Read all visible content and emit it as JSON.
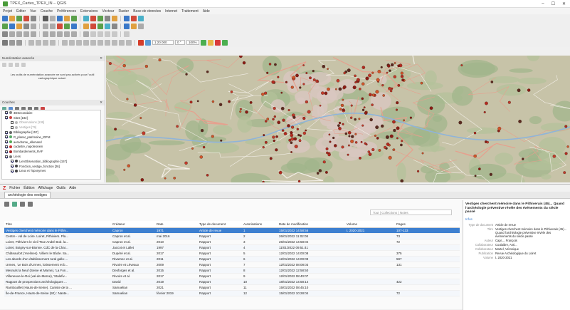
{
  "app": {
    "title": "TPEX_Cartes_TPEX_IN – QGIS"
  },
  "menubar": [
    "Projet",
    "Éditer",
    "Vue",
    "Couche",
    "Préférences",
    "Extensions",
    "Vecteur",
    "Raster",
    "Base de données",
    "Internet",
    "Traitement",
    "Aide"
  ],
  "window_controls": [
    "–",
    "☐",
    "✕"
  ],
  "scale": {
    "value": "1:20 000",
    "rotation": "0 °",
    "zoom": "100%"
  },
  "left_panel": {
    "title1": "Numérotation avancée",
    "warning": "Les outils de numérotation avancée ne sont pas activés pour l'outil cartographique actuel.",
    "title2": "Couches",
    "layers": [
      {
        "label": "3DSecondaire",
        "checked": true,
        "color": "#888"
      },
      {
        "label": "Sites [192]",
        "checked": true,
        "color": "#c44"
      },
      {
        "label": "Observations [136]",
        "checked": false,
        "color": "#bbb"
      },
      {
        "label": "Vestiges [79]",
        "checked": false,
        "color": "#bbb"
      },
      {
        "label": "Bibliographie [157]",
        "checked": true,
        "color": "#666"
      },
      {
        "label": "R_planar_patrimoine_IDFM",
        "checked": true,
        "color": "#5a6"
      },
      {
        "label": "aerodrome_allemand",
        "checked": true,
        "color": "#5a5"
      },
      {
        "label": "cadastre_napoleonien",
        "checked": true,
        "color": "#c33"
      },
      {
        "label": "Bombardements_RAF",
        "checked": true,
        "color": "#a22"
      },
      {
        "label": "Liens",
        "checked": true,
        "color": "#777"
      },
      {
        "label": "LienObservation_bibliographie [157]",
        "checked": true,
        "color": "#444"
      },
      {
        "label": "Fonction_vestige_fonction [26]",
        "checked": true,
        "color": "#444"
      },
      {
        "label": "Lieux et Toponymes",
        "checked": true,
        "color": "#444"
      }
    ]
  },
  "attribute_table": {
    "menu": [
      "Fichier",
      "Édition",
      "Affichage",
      "Outils",
      "Aide"
    ],
    "tab": "archéologie des vestiges",
    "search_placeholder": "Tout | Collections | Notes",
    "columns": [
      "Titre",
      "Créateur",
      "Date",
      "Type de document",
      "Autorisations",
      "Date de modification",
      "Volume",
      "Pages"
    ],
    "rows": [
      {
        "c": [
          "Vestiges cherchent mémoire dans le Pithiv...",
          "Capron",
          "1971",
          "Article de revue",
          "1",
          "15/01/2022 14:58:56",
          "t. 2020-2021",
          "107-133"
        ],
        "selected": true
      },
      {
        "c": [
          "Centre - val de Loire. Loiret, Pithiviers. Pla...",
          "Capron et al.",
          "mai 2016",
          "Rapport",
          "2",
          "26/01/2022 11:02:08",
          "",
          "73"
        ],
        "selected": false
      },
      {
        "c": [
          "Loiret, Pithiviers le vieil 'Rue André Bob. la...",
          "Capron et al.",
          "2010",
          "Rapport",
          "3",
          "26/01/2022 14:58:04",
          "",
          "72"
        ],
        "selected": false
      },
      {
        "c": [
          "Loiret, Boigny-sur-Bionne. CdC de la Char...",
          "Jaccot et Lallet",
          "1997",
          "Rapport",
          "4",
          "11/01/2022 09:51:41",
          "",
          "",
          ""
        ],
        "selected": false
      },
      {
        "c": [
          "Châteaufort (Yvelines). Villiers le Bâcle. Sa...",
          "Dupéré et al.",
          "2017",
          "Rapport",
          "5",
          "12/01/2022 14:00:08",
          "",
          "375"
        ],
        "selected": false
      },
      {
        "c": [
          "Les abords d'un établissement rural gallo-...",
          "Rivarnec et al.",
          "2011",
          "Rapport",
          "6",
          "12/01/2022 14:00:09",
          "",
          "597"
        ],
        "selected": false
      },
      {
        "c": [
          "Urmes, 'Le Bois d'Urmes, lotissement et b...",
          "Rivoire et Léveaux",
          "2009",
          "Rapport",
          "7",
          "12/01/2022 08:08:03",
          "",
          "131"
        ],
        "selected": false
      },
      {
        "c": [
          "Mesnuls la Neuf (Seine et Marne), 'La Fon...",
          "Desforges et al.",
          "2015",
          "Rapport",
          "8",
          "12/01/2022 12:58:50",
          "",
          "",
          ""
        ],
        "selected": false
      },
      {
        "c": [
          "Villeneuve-le-Roi (val-de-Marne), 'Stalefiv...",
          "Rivoire et al.",
          "2017",
          "Rapport",
          "9",
          "12/01/2022 08:40:07",
          "",
          "",
          ""
        ],
        "selected": false
      },
      {
        "c": [
          "Rapport de prospections archéologiques ...",
          "David",
          "2019",
          "Rapport",
          "10",
          "18/01/2022 14:58:14",
          "",
          "422"
        ],
        "selected": false
      },
      {
        "c": [
          "Rambouillet (Hauts-de-Seine). Caniste de la ...",
          "Samuelian",
          "2021",
          "Rapport",
          "11",
          "15/01/2022 08:45:10",
          "",
          "",
          ""
        ],
        "selected": false
      },
      {
        "c": [
          "Île-de-France, Hauts-de-Seine (92) : Nante...",
          "Samuelian",
          "février 2019",
          "Rapport",
          "12",
          "15/01/2022 10:28:04",
          "",
          "72"
        ],
        "selected": false
      }
    ]
  },
  "detail_panel": {
    "title": "Vestiges cherchent mémoire dans le Pithiverais (45)... Quand l'archéologie préventive révèle des événements du siècle passé",
    "section": "Infos",
    "fields": [
      {
        "k": "Type de document",
        "v": "Article de revue"
      },
      {
        "k": "Titre",
        "v": "Vestiges cherchent mémoire dans le Pithiverais (45)... Quand l'archéologie préventive révèle des événements du siècle passé"
      },
      {
        "k": "Auteur",
        "v": "Capr..., François"
      },
      {
        "k": "Collaborateur",
        "v": "Coulaibre, Anti..."
      },
      {
        "k": "Collaborateur",
        "v": "Martel, Véronique"
      },
      {
        "k": "Publication",
        "v": "Revue Archéologique du Loiret"
      },
      {
        "k": "Volume",
        "v": "t. 2020-2021"
      }
    ]
  }
}
